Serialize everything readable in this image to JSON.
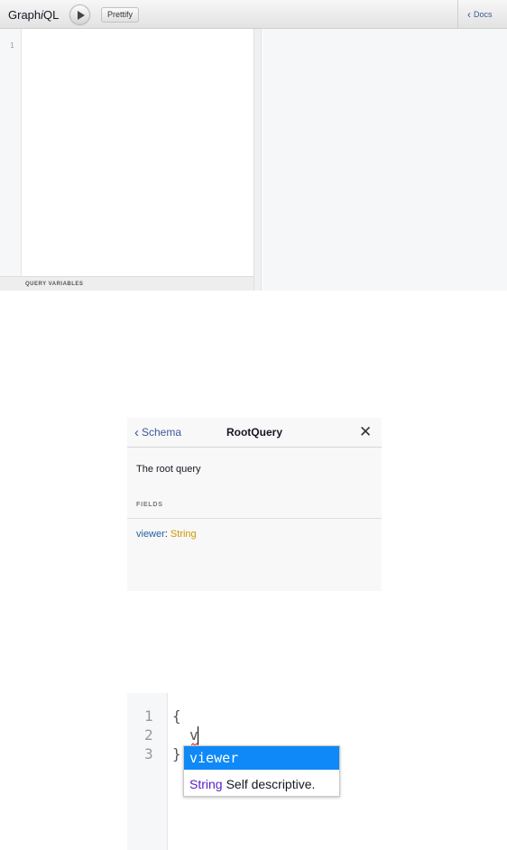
{
  "graphiql": {
    "title_prefix": "Graph",
    "title_italic": "i",
    "title_suffix": "QL",
    "prettify_label": "Prettify",
    "docs_label": "Docs",
    "line_number": "1",
    "variables_label": "QUERY VARIABLES"
  },
  "doc_explorer": {
    "back_label": "Schema",
    "title": "RootQuery",
    "description": "The root query",
    "fields_label": "FIELDS",
    "field_name": "viewer",
    "field_separator": ": ",
    "field_type": "String"
  },
  "autocomplete": {
    "line_numbers": [
      "1",
      "2",
      "3"
    ],
    "line1": "{",
    "line2": "v",
    "line3": "}",
    "hint_text": "viewer",
    "hint_type": "String",
    "hint_description": "Self descriptive."
  },
  "colors": {
    "link": "#3b5998",
    "field_name": "#1f61a0",
    "field_type": "#ca9800",
    "hint_active": "#0e89f7",
    "hint_type": "#5a1ec8"
  },
  "icons": [
    "play-icon",
    "chevron-left-icon",
    "close-icon"
  ]
}
